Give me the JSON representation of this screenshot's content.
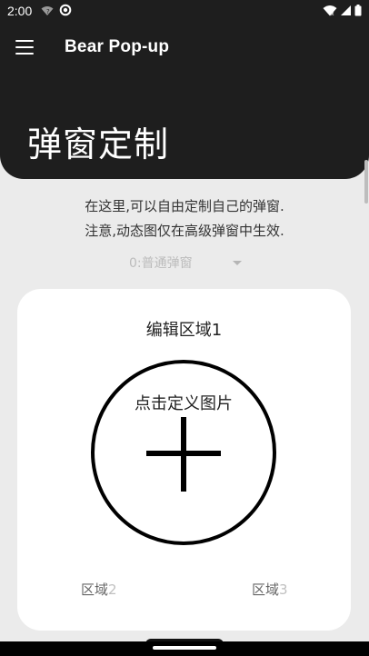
{
  "status_bar": {
    "time": "2:00",
    "left_icons": [
      "wifi-question-icon",
      "data-saver-icon"
    ],
    "right_icons": [
      "wifi-icon",
      "signal-icon",
      "battery-icon"
    ]
  },
  "toolbar": {
    "menu_icon": "menu-icon",
    "app_title": "Bear Pop-up"
  },
  "header": {
    "title": "弹窗定制"
  },
  "description": {
    "line1": "在这里,可以自由定制自己的弹窗.",
    "line2": "注意,动态图仅在高级弹窗中生效."
  },
  "selector": {
    "selected": "0:普通弹窗"
  },
  "editor": {
    "area_title": "编辑区域1",
    "image_prompt": "点击定义图片",
    "area2_label": "区域",
    "area2_number": "2",
    "area3_label": "区域",
    "area3_number": "3"
  },
  "colors": {
    "header_bg": "#1e1e1e",
    "page_bg": "#ebebeb",
    "card_bg": "#ffffff",
    "accent": "#000000"
  }
}
